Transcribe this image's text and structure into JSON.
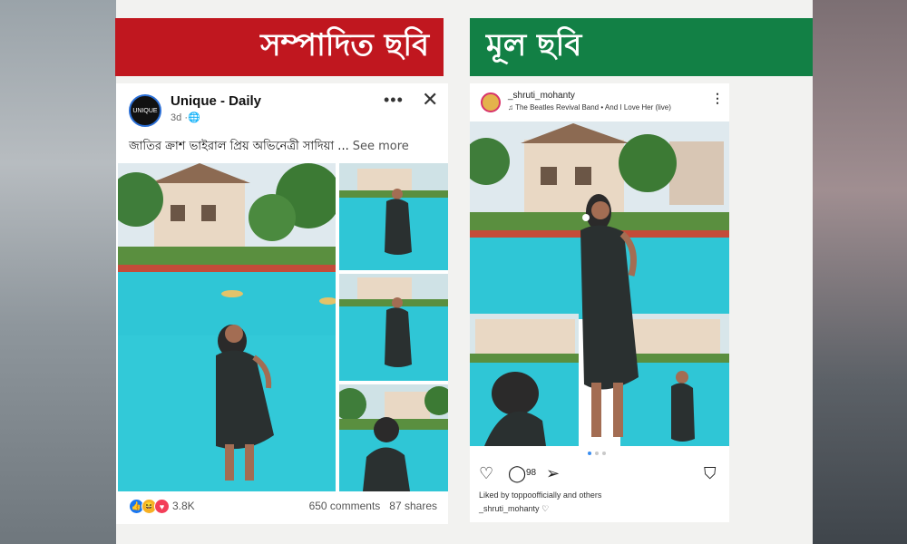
{
  "labels": {
    "edited": "সম্পাদিত ছবি",
    "original": "মূল ছবি"
  },
  "facebook": {
    "page_name": "Unique - Daily",
    "avatar_text": "UNIQUE",
    "time": "3d",
    "caption": "জাতির ক্রাশ ভাইরাল প্রিয় অভিনেত্রী সাদিয়া ...",
    "see_more": "See more",
    "reaction_count": "3.8K",
    "comments": "650 comments",
    "shares": "87 shares"
  },
  "instagram": {
    "username": "_shruti_mohanty",
    "song": "The Beatles Revival Band • And I Love Her (live)",
    "comment_count": "98",
    "liked_by": "Liked by toppoofficially and others",
    "caption_user": "_shruti_mohanty"
  },
  "colors": {
    "edited_banner": "#c0171f",
    "original_banner": "#128045",
    "pool": "#2fc6d6"
  }
}
